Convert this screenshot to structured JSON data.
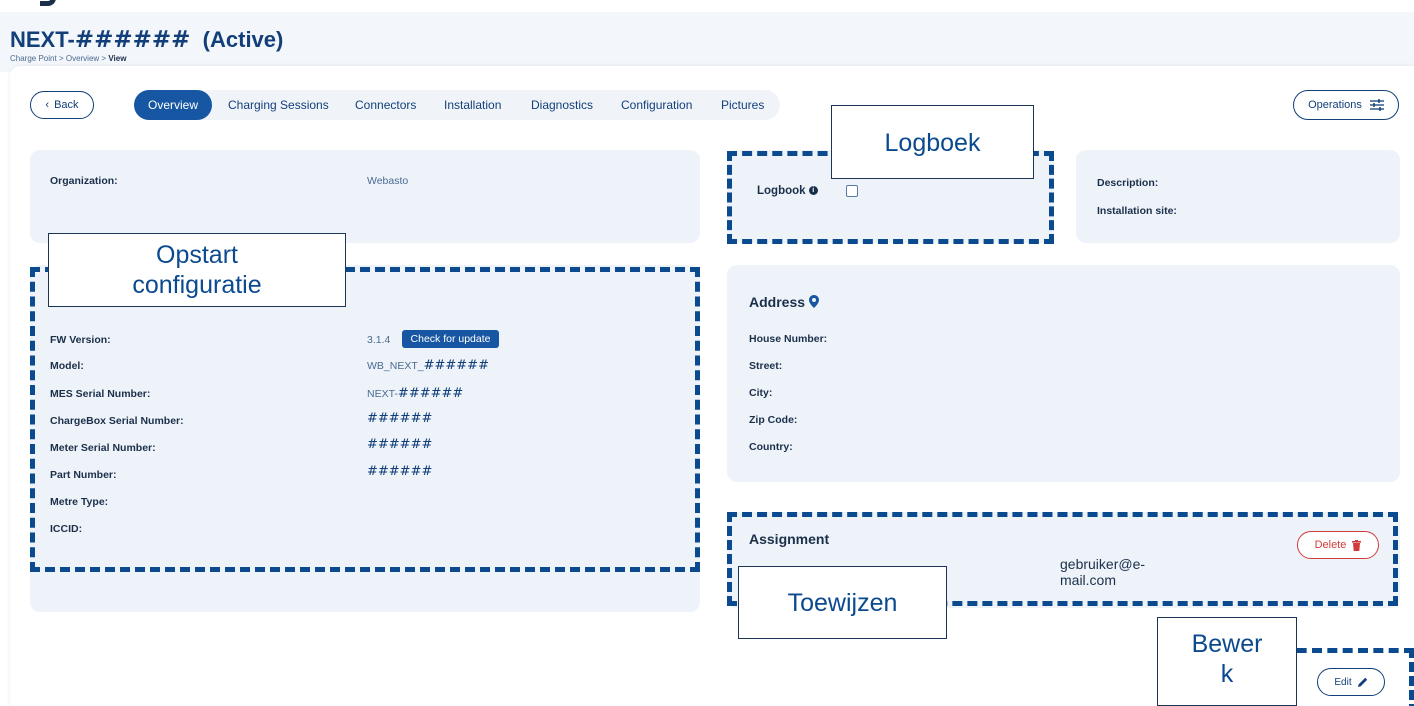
{
  "page": {
    "title_prefix": "NEXT-",
    "title_hash": "######",
    "title_status": "(Active)",
    "breadcrumb": [
      "Charge Point",
      "Overview",
      "View"
    ],
    "breadcrumb_sep": ">"
  },
  "nav": {
    "back_label": "Back",
    "tabs": [
      "Overview",
      "Charging Sessions",
      "Connectors",
      "Installation",
      "Diagnostics",
      "Configuration",
      "Pictures"
    ],
    "active_tab": "Overview",
    "operations_label": "Operations"
  },
  "organization": {
    "label": "Organization:",
    "value": "Webasto"
  },
  "logbook": {
    "label": "Logbook",
    "checked": false
  },
  "description": {
    "description_label": "Description:",
    "installation_site_label": "Installation site:"
  },
  "config": {
    "fw_label": "FW Version:",
    "fw_value": "3.1.4",
    "check_update_label": "Check for update",
    "model_label": "Model:",
    "model_prefix": "WB_NEXT_",
    "model_hash": "######",
    "mes_label": "MES Serial Number:",
    "mes_prefix": "NEXT-",
    "mes_hash": "######",
    "chargebox_label": "ChargeBox Serial Number:",
    "chargebox_value": "######",
    "meter_serial_label": "Meter Serial Number:",
    "meter_serial_value": "######",
    "part_label": "Part Number:",
    "part_value": "######",
    "metre_type_label": "Metre Type:",
    "iccid_label": "ICCID:"
  },
  "address": {
    "title": "Address",
    "house_number_label": "House Number:",
    "street_label": "Street:",
    "city_label": "City:",
    "zip_label": "Zip Code:",
    "country_label": "Country:"
  },
  "assignment": {
    "title": "Assignment",
    "delete_label": "Delete",
    "email_line1": "gebruiker@e-",
    "email_line2": "mail.com"
  },
  "edit_label": "Edit",
  "annotations": {
    "logboek": "Logboek",
    "opstart_line1": "Opstart",
    "opstart_line2": "configuratie",
    "toewijzen": "Toewijzen",
    "bewerk_line1": "Bewer",
    "bewerk_line2": "k"
  },
  "colors": {
    "primary": "#1756a3",
    "title": "#123f7a",
    "card_bg": "#eef3f9",
    "annotation_dash": "#0b4a8f",
    "delete": "#d23b3b"
  }
}
